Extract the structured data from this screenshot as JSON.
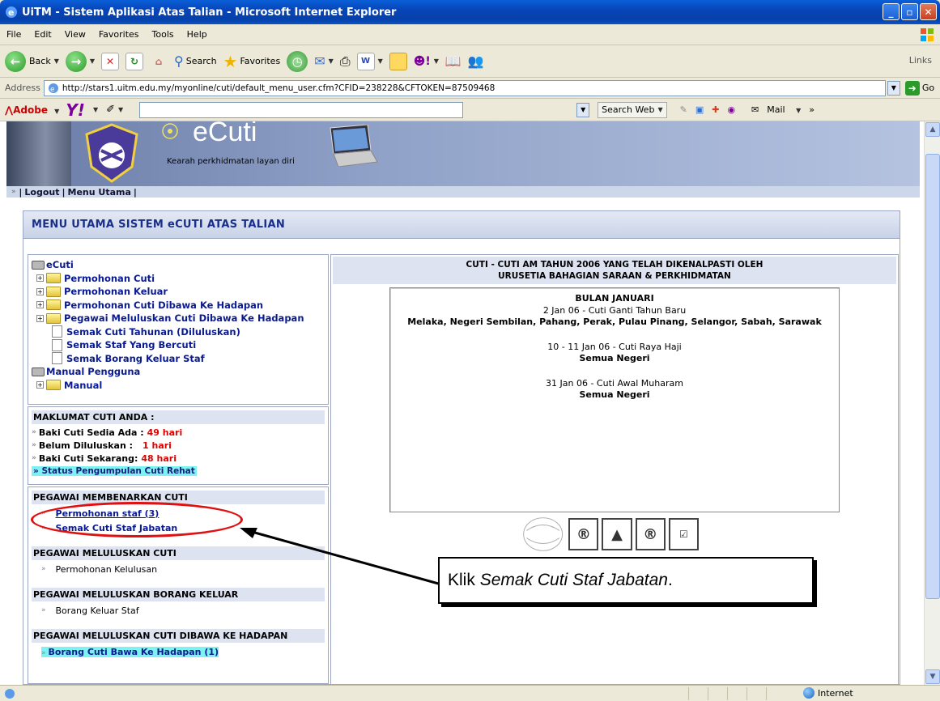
{
  "window": {
    "title": "UiTM - Sistem Aplikasi Atas Talian - Microsoft Internet Explorer"
  },
  "menu": [
    "File",
    "Edit",
    "View",
    "Favorites",
    "Tools",
    "Help"
  ],
  "toolbar": {
    "back": "Back",
    "search": "Search",
    "favorites": "Favorites",
    "links": "Links"
  },
  "address": {
    "label": "Address",
    "url": "http://stars1.uitm.edu.my/myonline/cuti/default_menu_user.cfm?CFID=238228&CFTOKEN=87509468",
    "go": "Go"
  },
  "yahoo_bar": {
    "adobe": "Adobe",
    "search_web": "Search Web",
    "mail": "Mail"
  },
  "banner": {
    "title": "eCuti",
    "tagline": "Kearah perkhidmatan layan diri"
  },
  "nav": {
    "logout": "Logout",
    "menu_utama": "Menu Utama"
  },
  "panel": {
    "title": "MENU UTAMA SISTEM eCUTI ATAS TALIAN"
  },
  "tree": {
    "root": "eCuti",
    "items": [
      "Permohonan Cuti",
      "Permohonan Keluar",
      "Permohonan Cuti Dibawa Ke Hadapan",
      "Pegawai Meluluskan Cuti Dibawa Ke Hadapan"
    ],
    "docs": [
      "Semak Cuti Tahunan (Diluluskan)",
      "Semak Staf Yang Bercuti",
      "Semak Borang Keluar Staf"
    ],
    "manual_root": "Manual Pengguna",
    "manual": "Manual"
  },
  "leave_info": {
    "heading": "MAKLUMAT CUTI ANDA :",
    "rows": [
      {
        "label": "Baki Cuti Sedia Ada :",
        "value": "49 hari"
      },
      {
        "label": "Belum Diluluskan :",
        "value": "1 hari"
      },
      {
        "label": "Baki Cuti Sekarang:",
        "value": "48 hari"
      }
    ],
    "status_link": "Status Pengumpulan Cuti Rehat"
  },
  "approver": {
    "groups": [
      {
        "heading": "PEGAWAI MEMBENARKAN CUTI",
        "items": [
          "Permohonan staf (3)",
          "Semak Cuti Staf Jabatan"
        ]
      },
      {
        "heading": "PEGAWAI MELULUSKAN CUTI",
        "items": [
          "Permohonan Kelulusan"
        ]
      },
      {
        "heading": "PEGAWAI MELULUSKAN BORANG KELUAR",
        "items": [
          "Borang Keluar Staf"
        ]
      },
      {
        "heading": "PEGAWAI MELULUSKAN CUTI DIBAWA KE HADAPAN",
        "items": [
          "Borang Cuti Bawa Ke Hadapan  (1)"
        ]
      }
    ]
  },
  "holidays": {
    "title_line1": "CUTI - CUTI AM TAHUN 2006 YANG TELAH DIKENALPASTI OLEH",
    "title_line2": "URUSETIA BAHAGIAN SARAAN & PERKHIDMATAN",
    "month": "BULAN JANUARI",
    "entries": [
      {
        "date": "2 Jan 06 - Cuti Ganti Tahun Baru",
        "states": "Melaka, Negeri Sembilan, Pahang, Perak, Pulau Pinang, Selangor, Sabah, Sarawak"
      },
      {
        "date": "10 - 11 Jan 06 - Cuti Raya Haji",
        "states": "Semua Negeri"
      },
      {
        "date": "31 Jan 06 - Cuti Awal Muharam",
        "states": "Semua Negeri"
      }
    ]
  },
  "callout": {
    "prefix": "Klik ",
    "emph": "Semak Cuti Staf Jabatan",
    "suffix": "."
  },
  "statusbar": {
    "zone": "Internet"
  },
  "colors": {
    "title_bar": "#0a55c8",
    "link": "#0a1a90",
    "red_value": "#e00000",
    "highlight": "#7ef2f2",
    "oval": "#e01010"
  }
}
